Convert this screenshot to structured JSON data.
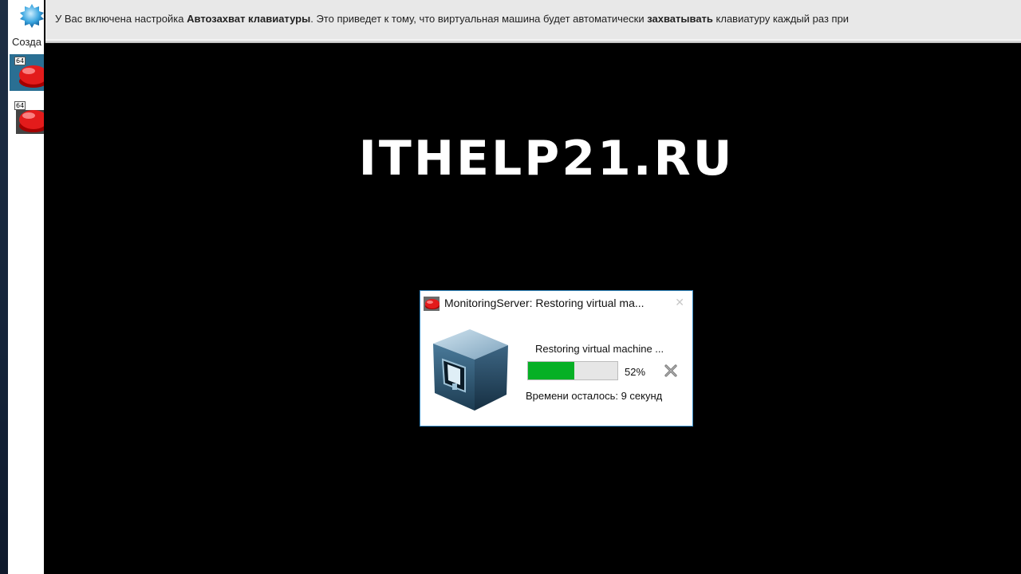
{
  "sidebar": {
    "new_label": "Созда",
    "vm_badge": "64"
  },
  "infobar": {
    "text_before": "У Вас включена настройка ",
    "bold_setting": "Автозахват клавиатуры",
    "text_middle": ". Это приведет к тому, что виртуальная машина будет автоматически ",
    "bold_action": "захватывать",
    "text_after": " клавиатуру каждый раз при"
  },
  "screen": {
    "logo": "ITHELP21.RU"
  },
  "dialog": {
    "title": "MonitoringServer: Restoring virtual ma...",
    "status": "Restoring virtual machine ...",
    "progress_percent": 52,
    "progress_label": "52%",
    "time_left": "Времени осталось: 9 секунд"
  },
  "colors": {
    "progress_fill": "#06b025",
    "dialog_border": "#3a8ec8",
    "selected_vm": "#2a6f93"
  }
}
